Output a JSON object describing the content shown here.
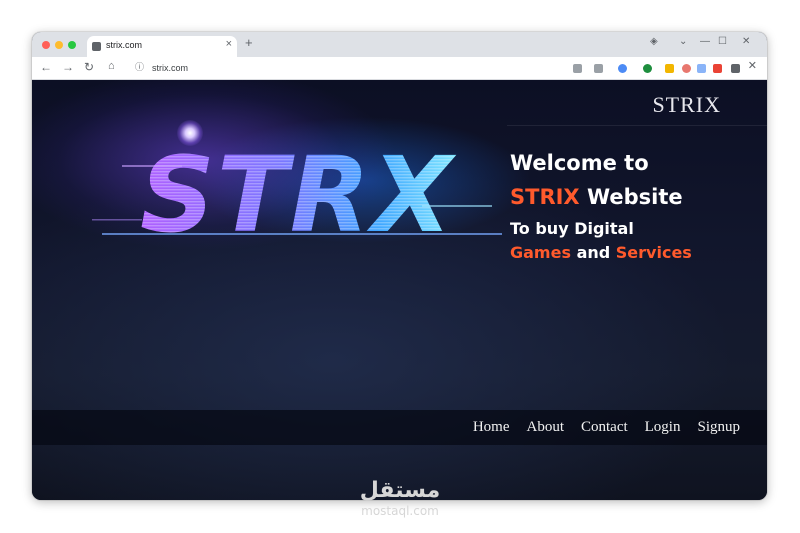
{
  "browser": {
    "tab_title": "strix.com",
    "tab_close": "×",
    "new_tab": "+",
    "url": "strix.com",
    "icons": [
      "back-icon",
      "forward-icon",
      "reload-icon",
      "home-icon",
      "site-info-icon",
      "bookmark-icon",
      "minimize-icon",
      "maximize-icon",
      "close-icon"
    ]
  },
  "site": {
    "brand": "STRIX",
    "hero_logo": "STRX",
    "welcome_line1": "Welcome to",
    "welcome_brand": "STRIX",
    "welcome_website": "Website",
    "welcome_line3": "To buy Digital",
    "welcome_games": "Games",
    "welcome_and": "and",
    "welcome_services": "Services",
    "accent_color": "#ff5a2c",
    "nav": [
      {
        "label": "Home"
      },
      {
        "label": "About"
      },
      {
        "label": "Contact"
      },
      {
        "label": "Login"
      },
      {
        "label": "Signup"
      }
    ]
  },
  "watermark": {
    "arabic": "مستقل",
    "latin": "mostaql.com"
  }
}
